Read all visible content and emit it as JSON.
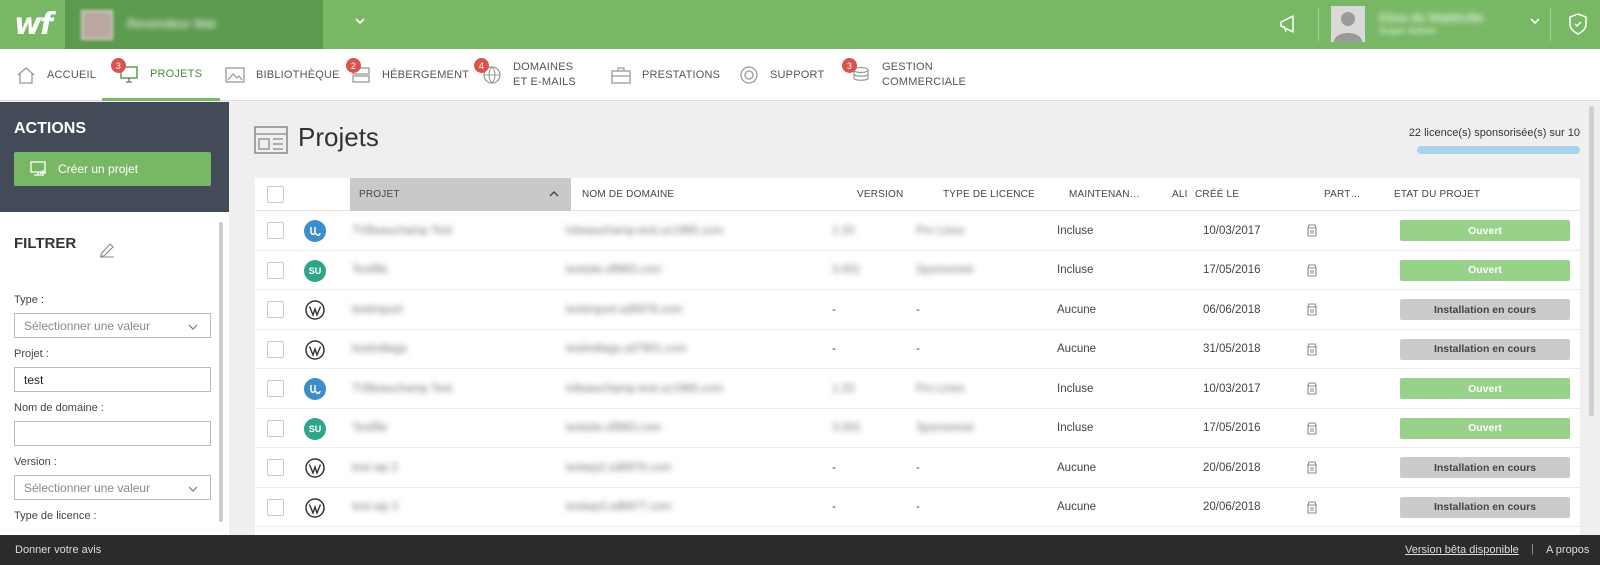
{
  "topbar": {
    "logo": "wf",
    "account_name": "Revendeur Mat",
    "user_name": "Elisa de Mattéville",
    "user_subtitle": "Super Admin",
    "icons": [
      "megaphone-icon",
      "shield-badge-icon"
    ],
    "accent": "#78b865"
  },
  "nav": [
    {
      "label": "ACCUEIL",
      "icon": "home-icon",
      "badge": ""
    },
    {
      "label": "PROJETS",
      "icon": "monitor-icon",
      "badge": "3",
      "active": true
    },
    {
      "label": "BIBLIOTHÈQUE",
      "icon": "image-icon",
      "badge": ""
    },
    {
      "label": "HÉBERGEMENT",
      "icon": "server-icon",
      "badge": "2"
    },
    {
      "label": "DOMAINES",
      "label2": "ET E-MAILS",
      "icon": "globe-mail-icon",
      "badge": "4"
    },
    {
      "label": "PRESTATIONS",
      "icon": "briefcase-icon",
      "badge": ""
    },
    {
      "label": "SUPPORT",
      "icon": "lifebuoy-icon",
      "badge": ""
    },
    {
      "label": "GESTION",
      "label2": "COMMERCIALE",
      "icon": "coins-icon",
      "badge": "3"
    }
  ],
  "sidebar": {
    "actions_title": "ACTIONS",
    "create_label": "Créer un projet",
    "filter_title": "FILTRER",
    "filters": [
      {
        "label": "Type :",
        "value": "Sélectionner une valeur",
        "kind": "select"
      },
      {
        "label": "Projet :",
        "value": "test",
        "kind": "input"
      },
      {
        "label": "Nom de domaine :",
        "value": "",
        "kind": "input"
      },
      {
        "label": "Version :",
        "value": "Sélectionner une valeur",
        "kind": "select"
      },
      {
        "label": "Type de licence :",
        "value": "",
        "kind": "select"
      }
    ]
  },
  "main": {
    "title": "Projets",
    "licences_text": "22 licence(s) sponsorisée(s) sur 10",
    "licences_fill": 1.0
  },
  "table": {
    "headers": [
      "PROJET",
      "NOM DE DOMAINE",
      "VERSION",
      "TYPE DE LICENCE",
      "MAINTENAN…",
      "ALI",
      "CRÉÉ LE",
      "PART…",
      "ETAT DU PROJET"
    ],
    "rows": [
      {
        "app": "uc",
        "app_label": "",
        "projet": "TVBeauchamp Test",
        "domaine": "tvbeauchamp-test.uc1985.com",
        "version": "1.33",
        "licence": "Pro Lines",
        "maintenance": "Incluse",
        "cree": "10/03/2017",
        "etat": "Ouvert",
        "etat_kind": "open"
      },
      {
        "app": "su",
        "app_label": "SU",
        "projet": "Testfile",
        "domaine": "testsite.sfl983.com",
        "version": "3.001",
        "licence": "Sponsorisé",
        "maintenance": "Incluse",
        "cree": "17/05/2016",
        "etat": "Ouvert",
        "etat_kind": "open"
      },
      {
        "app": "wp",
        "app_label": "W",
        "projet": "testimport",
        "domaine": "testimport.sd6978.com",
        "version": "-",
        "licence": "-",
        "maintenance": "Aucune",
        "cree": "06/06/2018",
        "etat": "Installation en cours",
        "etat_kind": "install"
      },
      {
        "app": "wp",
        "app_label": "W",
        "projet": "testindiags",
        "domaine": "testindiags.sd7901.com",
        "version": "-",
        "licence": "-",
        "maintenance": "Aucune",
        "cree": "31/05/2018",
        "etat": "Installation en cours",
        "etat_kind": "install"
      },
      {
        "app": "uc",
        "app_label": "",
        "projet": "TVBeauchamp Test",
        "domaine": "tvbeauchamp-test.uc1985.com",
        "version": "1.33",
        "licence": "Pro Lines",
        "maintenance": "Incluse",
        "cree": "10/03/2017",
        "etat": "Ouvert",
        "etat_kind": "open"
      },
      {
        "app": "su",
        "app_label": "SU",
        "projet": "Testfile",
        "domaine": "testsite.sfl983.com",
        "version": "3.001",
        "licence": "Sponsorisé",
        "maintenance": "Incluse",
        "cree": "17/05/2016",
        "etat": "Ouvert",
        "etat_kind": "open"
      },
      {
        "app": "wp",
        "app_label": "W",
        "projet": "test wp 2",
        "domaine": "testwp2.sd6976.com",
        "version": "-",
        "licence": "-",
        "maintenance": "Aucune",
        "cree": "20/06/2018",
        "etat": "Installation en cours",
        "etat_kind": "install"
      },
      {
        "app": "wp",
        "app_label": "W",
        "projet": "test wp 3",
        "domaine": "testwp3.sd6977.com",
        "version": "-",
        "licence": "-",
        "maintenance": "Aucune",
        "cree": "20/06/2018",
        "etat": "Installation en cours",
        "etat_kind": "install"
      }
    ]
  },
  "footer": {
    "feedback": "Donner votre avis",
    "beta": "Version bêta disponible",
    "separator": "|",
    "about": "A propos"
  }
}
